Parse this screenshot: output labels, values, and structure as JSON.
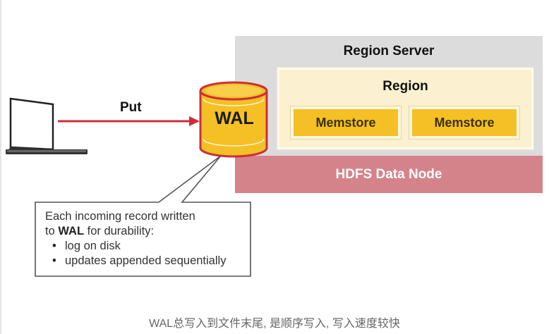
{
  "region_server": {
    "title": "Region Server"
  },
  "region": {
    "title": "Region"
  },
  "memstores": [
    {
      "label": "Memstore"
    },
    {
      "label": "Memstore"
    }
  ],
  "hdfs": {
    "label": "HDFS Data Node"
  },
  "put": {
    "label": "Put"
  },
  "wal": {
    "label": "WAL"
  },
  "callout": {
    "line1": "Each incoming record written",
    "line2_prefix": "to ",
    "line2_bold": "WAL",
    "line2_suffix": " for durability:",
    "bullets": [
      "log on disk",
      "updates appended sequentially"
    ]
  },
  "caption": "WAL总写入到文件末尾, 是顺序写入, 写入速度较快",
  "colors": {
    "arrow": "#cc2f3b",
    "wal_fill": "#f4c025",
    "wal_border": "#cc2f3b",
    "memstore": "#f4c025",
    "region": "#fbf0cf",
    "region_server": "#dcdcdc",
    "hdfs": "#d5838a"
  }
}
